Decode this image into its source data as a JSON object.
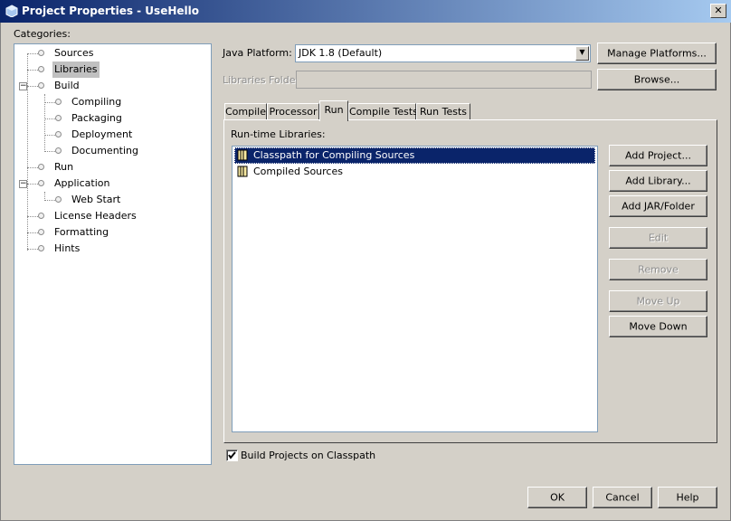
{
  "window": {
    "title": "Project Properties - UseHello",
    "close_glyph": "✕"
  },
  "categories": {
    "label": "Categories:",
    "items": [
      {
        "label": "Sources"
      },
      {
        "label": "Libraries",
        "selected": true
      },
      {
        "label": "Build",
        "expanded": true
      },
      {
        "label": "Compiling"
      },
      {
        "label": "Packaging"
      },
      {
        "label": "Deployment"
      },
      {
        "label": "Documenting"
      },
      {
        "label": "Run"
      },
      {
        "label": "Application",
        "expanded": true
      },
      {
        "label": "Web Start"
      },
      {
        "label": "License Headers"
      },
      {
        "label": "Formatting"
      },
      {
        "label": "Hints"
      }
    ]
  },
  "platform": {
    "label": "Java Platform:",
    "value": "JDK 1.8 (Default)",
    "manage_button": "Manage Platforms..."
  },
  "libraries_folder": {
    "label": "Libraries Folder:",
    "value": "",
    "browse_button": "Browse..."
  },
  "tabs": [
    {
      "label": "Compile"
    },
    {
      "label": "Processor"
    },
    {
      "label": "Run",
      "active": true
    },
    {
      "label": "Compile Tests"
    },
    {
      "label": "Run Tests"
    }
  ],
  "runtime_libraries": {
    "label": "Run-time Libraries:",
    "items": [
      {
        "label": "Classpath for Compiling Sources",
        "selected": true,
        "icon": "library-icon"
      },
      {
        "label": "Compiled Sources",
        "selected": false,
        "icon": "library-icon"
      }
    ]
  },
  "side_buttons": {
    "add_project": "Add Project...",
    "add_library": "Add Library...",
    "add_jar": "Add JAR/Folder",
    "edit": "Edit",
    "remove": "Remove",
    "move_up": "Move Up",
    "move_down": "Move Down"
  },
  "build_projects": {
    "label": "Build Projects on Classpath",
    "checked": true
  },
  "footer": {
    "ok": "OK",
    "cancel": "Cancel",
    "help": "Help"
  },
  "colors": {
    "title_gradient_start": "#0a246a",
    "title_gradient_end": "#a6caf0",
    "selection": "#0a246a",
    "dialog_bg": "#d4d0c8"
  }
}
